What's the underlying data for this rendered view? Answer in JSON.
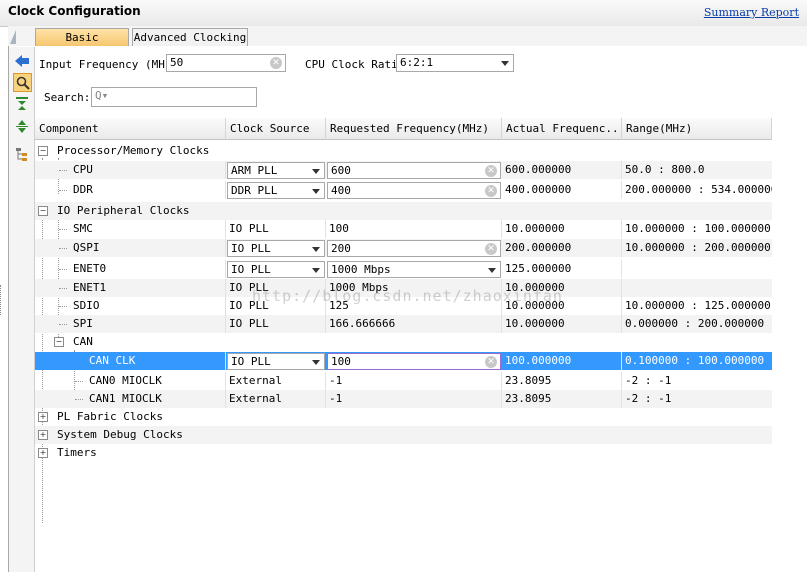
{
  "window": {
    "title": "Clock Configuration",
    "report_link": "Summary Report"
  },
  "tabs": [
    {
      "label": "Basic Clocking"
    },
    {
      "label": "Advanced Clocking"
    }
  ],
  "input_frequency": {
    "label": "Input Frequency (MHz)",
    "value": "50"
  },
  "cpu_clock_ratio": {
    "label": "CPU Clock Ratio",
    "value": "6:2:1"
  },
  "search": {
    "label": "Search:",
    "placeholder": "Q▾"
  },
  "columns": [
    "Component",
    "Clock Source",
    "Requested Frequency(MHz)",
    "Actual Frequenc...",
    "Range(MHz)"
  ],
  "rows": {
    "g1": {
      "label": "Processor/Memory Clocks"
    },
    "cpu": {
      "name": "CPU",
      "source": "ARM PLL",
      "req": "600",
      "actual": "600.000000",
      "range": "50.0 : 800.0"
    },
    "ddr": {
      "name": "DDR",
      "source": "DDR PLL",
      "req": "400",
      "actual": "400.000000",
      "range": "200.000000 : 534.000000"
    },
    "g2": {
      "label": "IO Peripheral Clocks"
    },
    "smc": {
      "name": "SMC",
      "source": "IO PLL",
      "req": "100",
      "actual": "10.000000",
      "range": "10.000000 : 100.000000"
    },
    "qspi": {
      "name": "QSPI",
      "source": "IO PLL",
      "req": "200",
      "actual": "200.000000",
      "range": "10.000000 : 200.000000"
    },
    "enet0": {
      "name": "ENET0",
      "source": "IO PLL",
      "req": "1000 Mbps",
      "actual": "125.000000",
      "range": ""
    },
    "enet1": {
      "name": "ENET1",
      "source": "IO PLL",
      "req": "1000 Mbps",
      "actual": "10.000000",
      "range": ""
    },
    "sdio": {
      "name": "SDIO",
      "source": "IO PLL",
      "req": "125",
      "actual": "10.000000",
      "range": "10.000000 : 125.000000"
    },
    "spi": {
      "name": "SPI",
      "source": "IO PLL",
      "req": "166.666666",
      "actual": "10.000000",
      "range": "0.000000 : 200.000000"
    },
    "can": {
      "name": "CAN"
    },
    "canclk": {
      "name": "CAN CLK",
      "source": "IO PLL",
      "req": "100",
      "actual": "100.000000",
      "range": "0.100000 : 100.000000"
    },
    "can0": {
      "name": "CAN0 MIOCLK",
      "source": "External",
      "req": "-1",
      "actual": "23.8095",
      "range": "-2 : -1"
    },
    "can1": {
      "name": "CAN1 MIOCLK",
      "source": "External",
      "req": "-1",
      "actual": "23.8095",
      "range": "-2 : -1"
    },
    "g3": {
      "label": "PL Fabric Clocks"
    },
    "g4": {
      "label": "System Debug Clocks"
    },
    "g5": {
      "label": "Timers"
    }
  },
  "watermark": "http://blog.csdn.net/zhaoxinfan"
}
